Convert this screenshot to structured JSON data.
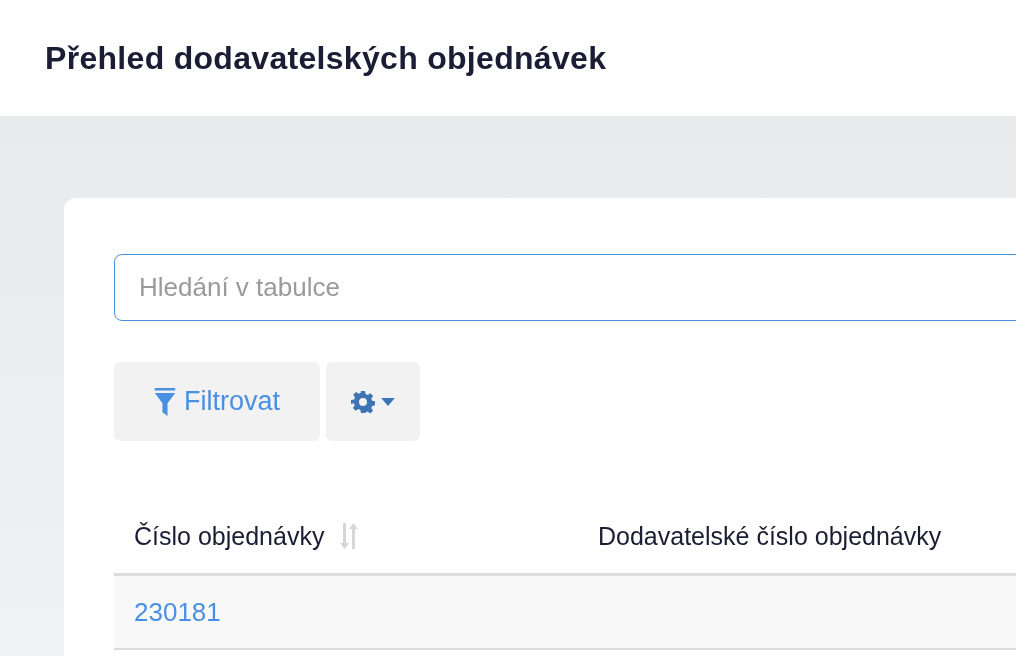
{
  "page": {
    "title": "Přehled dodavatelských objednávek"
  },
  "search": {
    "placeholder": "Hledání v tabulce",
    "focused": true
  },
  "toolbar": [
    {
      "kind": "filter",
      "label": "Filtrovat"
    },
    {
      "kind": "settings"
    }
  ],
  "table": {
    "columns": [
      {
        "label": "Číslo objednávky",
        "sortable": true
      },
      {
        "label": "Dodavatelské číslo objednávky",
        "sortable": false
      }
    ],
    "rows": [
      [
        "230181"
      ]
    ]
  }
}
